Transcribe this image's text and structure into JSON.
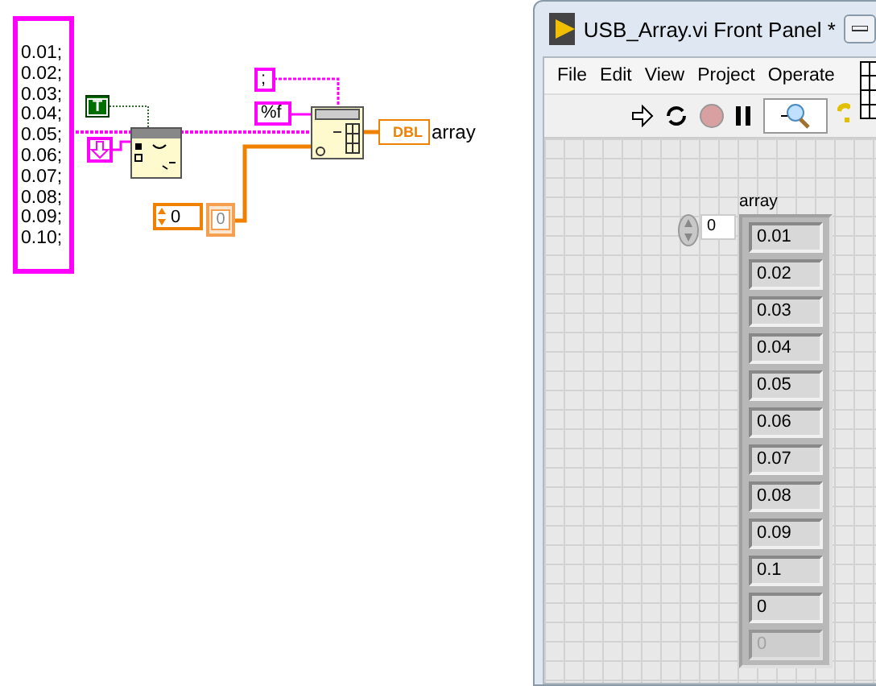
{
  "diagram": {
    "string_constant": {
      "lines": [
        "0.01;",
        "0.02;",
        "0.03;",
        "0.04;",
        "0.05;",
        "0.06;",
        "0.07;",
        "0.08;",
        "0.09;",
        "0.10;"
      ]
    },
    "boolean_constant": "T",
    "delimiter_constant": ";",
    "format_constant": "%f",
    "array_indicator": {
      "type": "DBL",
      "label": "array"
    },
    "index_control": "0",
    "index_display": "0"
  },
  "window": {
    "title": "USB_Array.vi Front Panel *",
    "menu": [
      "File",
      "Edit",
      "View",
      "Project",
      "Operate"
    ],
    "panel": {
      "array_label": "array",
      "index": "0",
      "elements": [
        {
          "value": "0.01",
          "disabled": false
        },
        {
          "value": "0.02",
          "disabled": false
        },
        {
          "value": "0.03",
          "disabled": false
        },
        {
          "value": "0.04",
          "disabled": false
        },
        {
          "value": "0.05",
          "disabled": false
        },
        {
          "value": "0.06",
          "disabled": false
        },
        {
          "value": "0.07",
          "disabled": false
        },
        {
          "value": "0.08",
          "disabled": false
        },
        {
          "value": "0.09",
          "disabled": false
        },
        {
          "value": "0.1",
          "disabled": false
        },
        {
          "value": "0",
          "disabled": false
        },
        {
          "value": "0",
          "disabled": true
        }
      ]
    }
  }
}
